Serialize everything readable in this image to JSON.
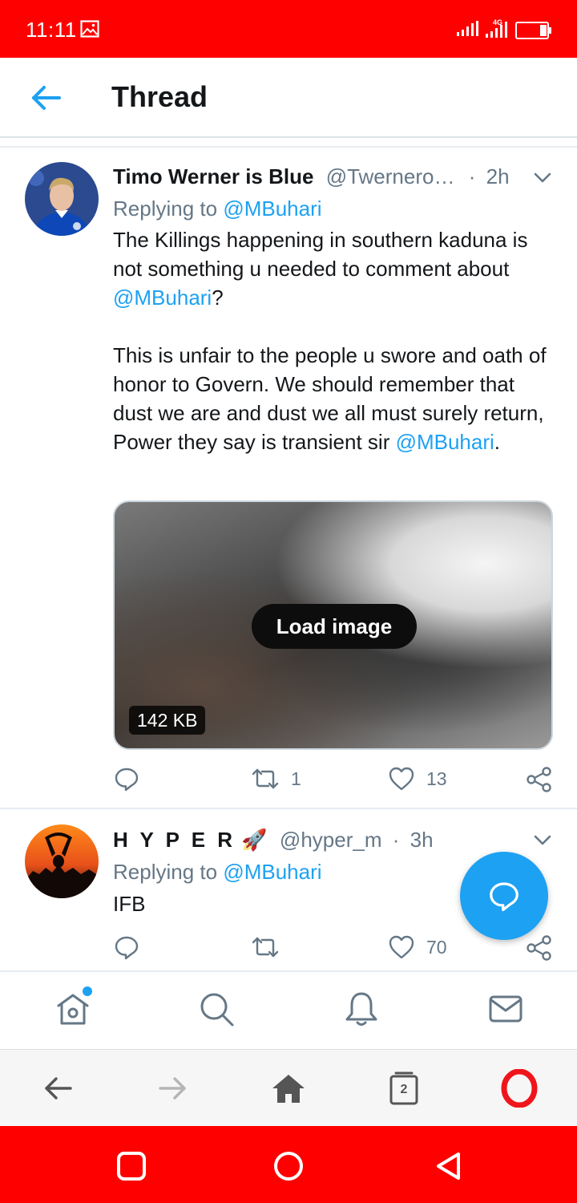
{
  "status_bar": {
    "time": "11:11",
    "network": "4G",
    "icons": [
      "image-icon",
      "signal-icon",
      "signal-4g-icon",
      "battery-icon"
    ]
  },
  "header": {
    "title": "Thread"
  },
  "tweets": [
    {
      "name": "Timo Werner is Blue",
      "handle": "@Twernero…",
      "sep": "·",
      "time": "2h",
      "replying_prefix": "Replying to ",
      "replying_to": "@MBuhari",
      "text": {
        "p1_a": "The Killings happening in southern kaduna is not something u needed to comment about ",
        "p1_mention": "@MBuhari",
        "p1_b": "?",
        "p2_a": "This is unfair to the people u swore and oath of honor to Govern. We should remember that dust we are and dust we all must surely return, Power they say is transient sir ",
        "p2_mention": "@MBuhari",
        "p2_b": "."
      },
      "media": {
        "button": "Load image",
        "size": "142 KB"
      },
      "actions": {
        "reply_count": "",
        "retweet_count": "1",
        "like_count": "13"
      }
    },
    {
      "name": "H Y P E R",
      "name_emoji": "🚀",
      "handle": "@hyper_m",
      "sep": "·",
      "time": "3h",
      "replying_prefix": "Replying to ",
      "replying_to": "@MBuhari",
      "text": "IFB",
      "actions": {
        "reply_count": "",
        "retweet_count": "",
        "like_count": "70"
      }
    }
  ],
  "bottom_tabs": [
    "home-icon",
    "search-icon",
    "notifications-icon",
    "messages-icon"
  ],
  "browser_bar": {
    "tab_count": "2"
  },
  "colors": {
    "accent": "#1da1f2",
    "status_bar": "#fe0000",
    "text_secondary": "#657786"
  }
}
